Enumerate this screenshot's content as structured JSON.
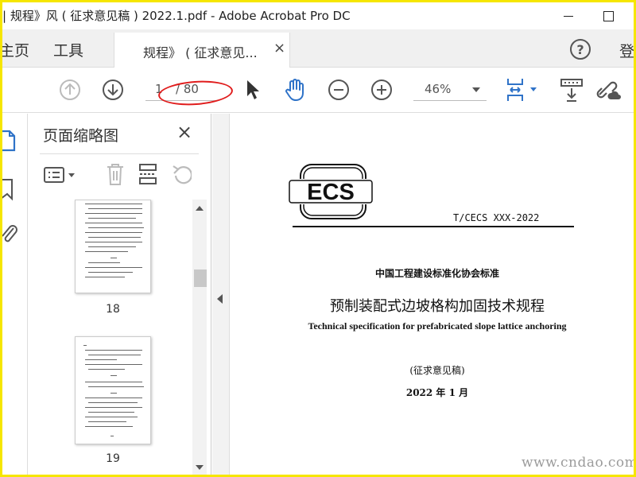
{
  "window": {
    "title": "| 规程》风 ( 征求意见稿 ) 2022.1.pdf - Adobe Acrobat Pro DC"
  },
  "tabs": {
    "home": "主页",
    "tools": "工具",
    "document": "规程》 ( 征求意见...",
    "close": "×",
    "help": "?",
    "signin": "登"
  },
  "toolbar": {
    "page_current": "1",
    "page_total": "/ 80",
    "zoom": "46%",
    "accent_color": "#2f73c8"
  },
  "thumbnails_panel": {
    "title": "页面缩略图",
    "close": "×",
    "pages": [
      {
        "number": "18"
      },
      {
        "number": "19"
      }
    ]
  },
  "document": {
    "logo_text": "ECS",
    "code": "T/CECS XXX-2022",
    "association": "中国工程建设标准化协会标准",
    "title_cn": "预制装配式边坡格构加固技术规程",
    "title_en": "Technical specification for prefabricated slope lattice anchoring",
    "draft": "(征求意见稿)",
    "date": "2022 年 1 月"
  },
  "watermark": "www.cndao.com",
  "annotation_color": "#e01c1c"
}
